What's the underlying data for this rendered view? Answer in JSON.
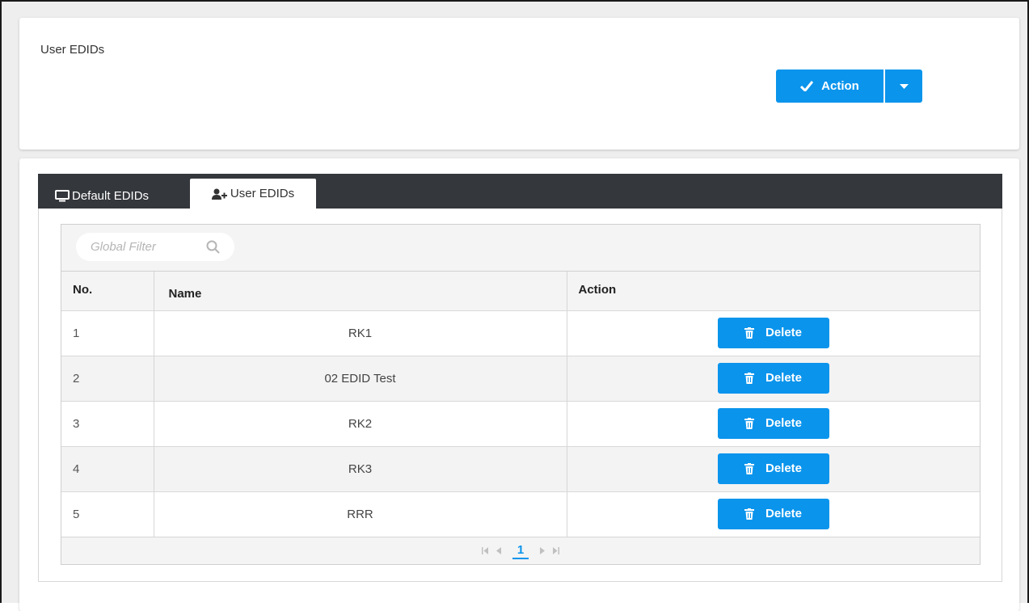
{
  "header": {
    "title": "User EDIDs",
    "action_label": "Action"
  },
  "tabs": [
    {
      "label": "Default EDIDs",
      "icon": "monitor-icon",
      "active": false
    },
    {
      "label": "User EDIDs",
      "icon": "user-add-icon",
      "active": true
    }
  ],
  "filter": {
    "placeholder": "Global Filter"
  },
  "table": {
    "columns": [
      "No.",
      "Name",
      "Action"
    ],
    "rows": [
      {
        "no": "1",
        "name": "RK1",
        "action": "Delete"
      },
      {
        "no": "2",
        "name": "02 EDID Test",
        "action": "Delete"
      },
      {
        "no": "3",
        "name": "RK2",
        "action": "Delete"
      },
      {
        "no": "4",
        "name": "RK3",
        "action": "Delete"
      },
      {
        "no": "5",
        "name": "RRR",
        "action": "Delete"
      }
    ]
  },
  "pagination": {
    "current_page": "1"
  },
  "colors": {
    "accent": "#0a94ec",
    "tab_bar": "#34373b"
  }
}
